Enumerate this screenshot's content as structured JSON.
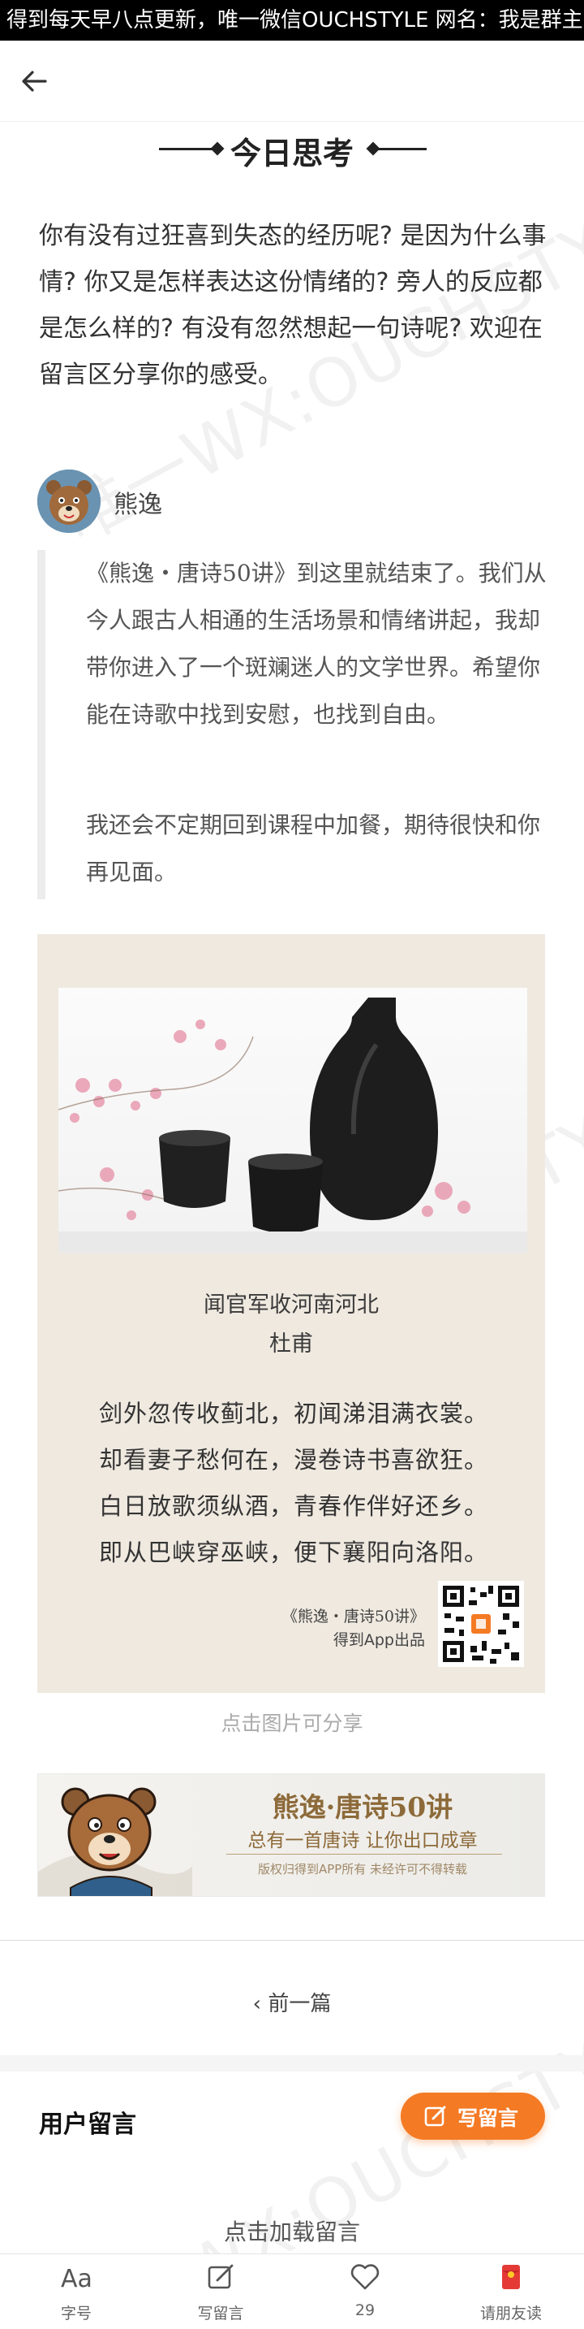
{
  "banner": {
    "text": "得到每天早八点更新，唯一微信OUCHSTYLE 网名：我是群主"
  },
  "watermark": {
    "text": "唯一WX:OUCHSTYLE"
  },
  "section": {
    "title": "今日思考"
  },
  "question": {
    "text": "你有没有过狂喜到失态的经历呢? 是因为什么事情? 你又是怎样表达这份情绪的? 旁人的反应都是怎么样的? 有没有忽然想起一句诗呢? 欢迎在留言区分享你的感受。"
  },
  "author": {
    "name": "熊逸"
  },
  "quote": {
    "p1": "《熊逸・唐诗50讲》到这里就结束了。我们从今人跟古人相通的生活场景和情绪讲起，我却带你进入了一个斑斓迷人的文学世界。希望你能在诗歌中找到安慰，也找到自由。",
    "p2": "我还会不定期回到课程中加餐，期待很快和你再见面。"
  },
  "poem": {
    "title": "闻官军收河南河北",
    "author": "杜甫",
    "lines": [
      "剑外忽传收蓟北，初闻涕泪满衣裳。",
      "却看妻子愁何在，漫卷诗书喜欲狂。",
      "白日放歌须纵酒，青春作伴好还乡。",
      "即从巴峡穿巫峡，便下襄阳向洛阳。"
    ],
    "footer_course": "《熊逸・唐诗50讲》",
    "footer_brand": "得到App出品"
  },
  "share_hint": "点击图片可分享",
  "ad": {
    "title": "熊逸·唐诗50讲",
    "subtitle": "总有一首唐诗 让你出口成章",
    "note": "版权归得到APP所有 未经许可不得转载"
  },
  "prev": {
    "label": "‹ 前一篇"
  },
  "comments": {
    "title": "用户留言",
    "write_label": "写留言",
    "load_more": "点击加载留言"
  },
  "tabbar": {
    "font": "字号",
    "write": "写留言",
    "likes": "29",
    "invite": "请朋友读"
  },
  "colors": {
    "accent": "#f47a24",
    "banner_bg": "#000000",
    "poem_bg": "#efe9e0"
  }
}
